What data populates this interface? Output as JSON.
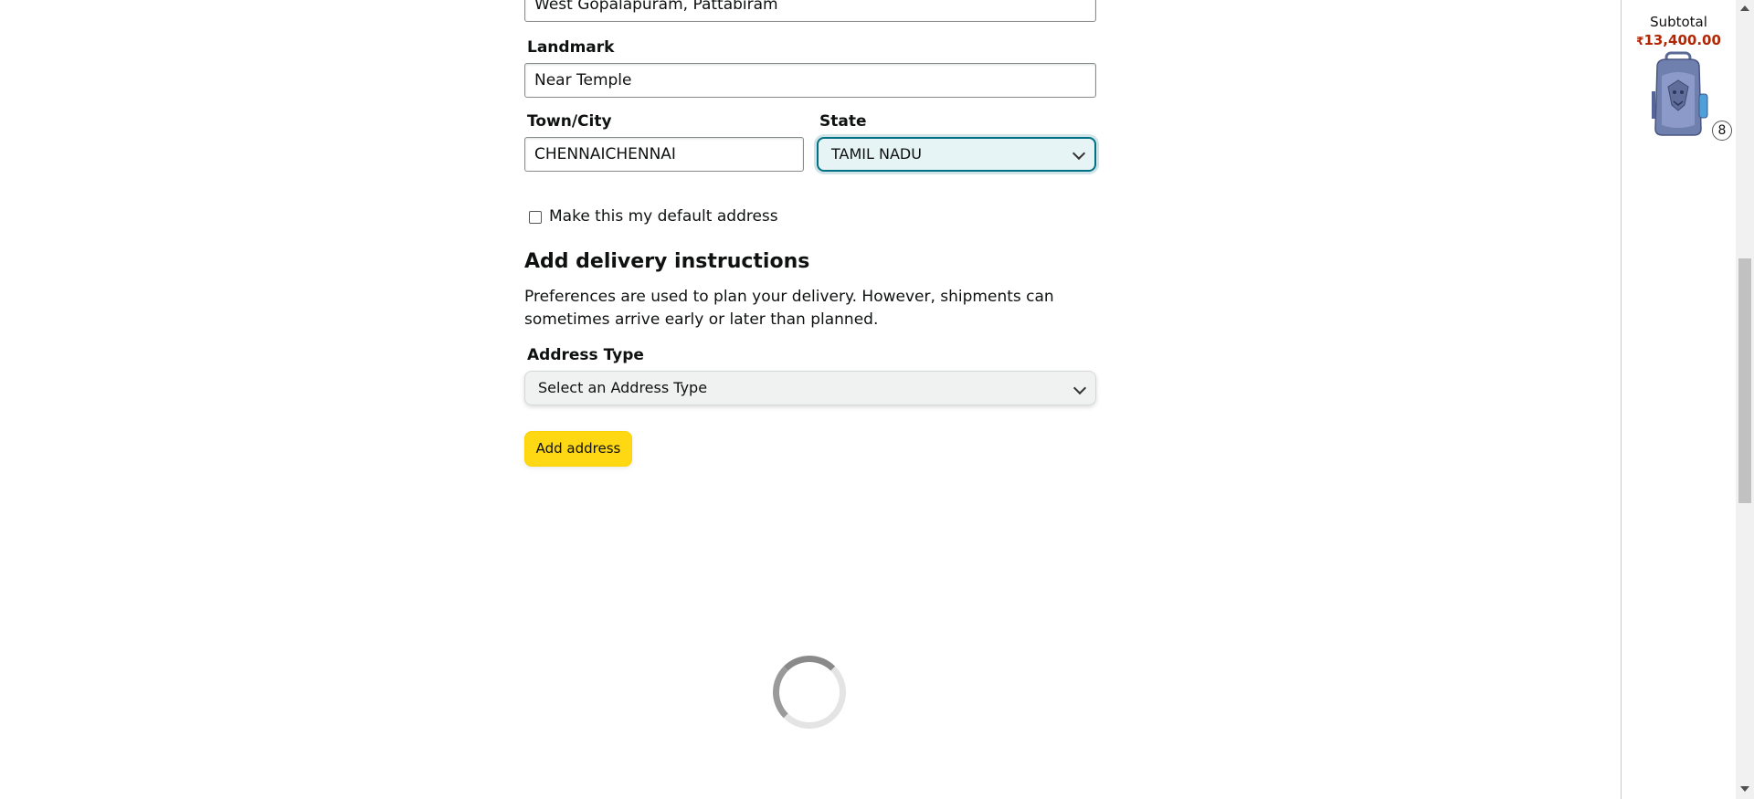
{
  "form": {
    "address_line2_value": "West Gopalapuram, Pattabiram",
    "landmark_label": "Landmark",
    "landmark_value": "Near Temple",
    "city_label": "Town/City",
    "city_value": "CHENNAICHENNAI",
    "state_label": "State",
    "state_value": "TAMIL NADU",
    "default_address_label": "Make this my default address",
    "default_address_checked": false,
    "delivery_heading": "Add delivery instructions",
    "delivery_description": "Preferences are used to plan your delivery. However, shipments can sometimes arrive early or later than planned.",
    "address_type_label": "Address Type",
    "address_type_value": "Select an Address Type",
    "add_address_button": "Add address"
  },
  "cart_panel": {
    "subtotal_label": "Subtotal",
    "currency_symbol": "₹",
    "subtotal_amount": "13,400.00",
    "item_quantity": "8",
    "item_icon": "backpack-image",
    "price_color": "#b12704"
  },
  "colors": {
    "focus_border": "#007185",
    "button_yellow": "#ffd814"
  }
}
